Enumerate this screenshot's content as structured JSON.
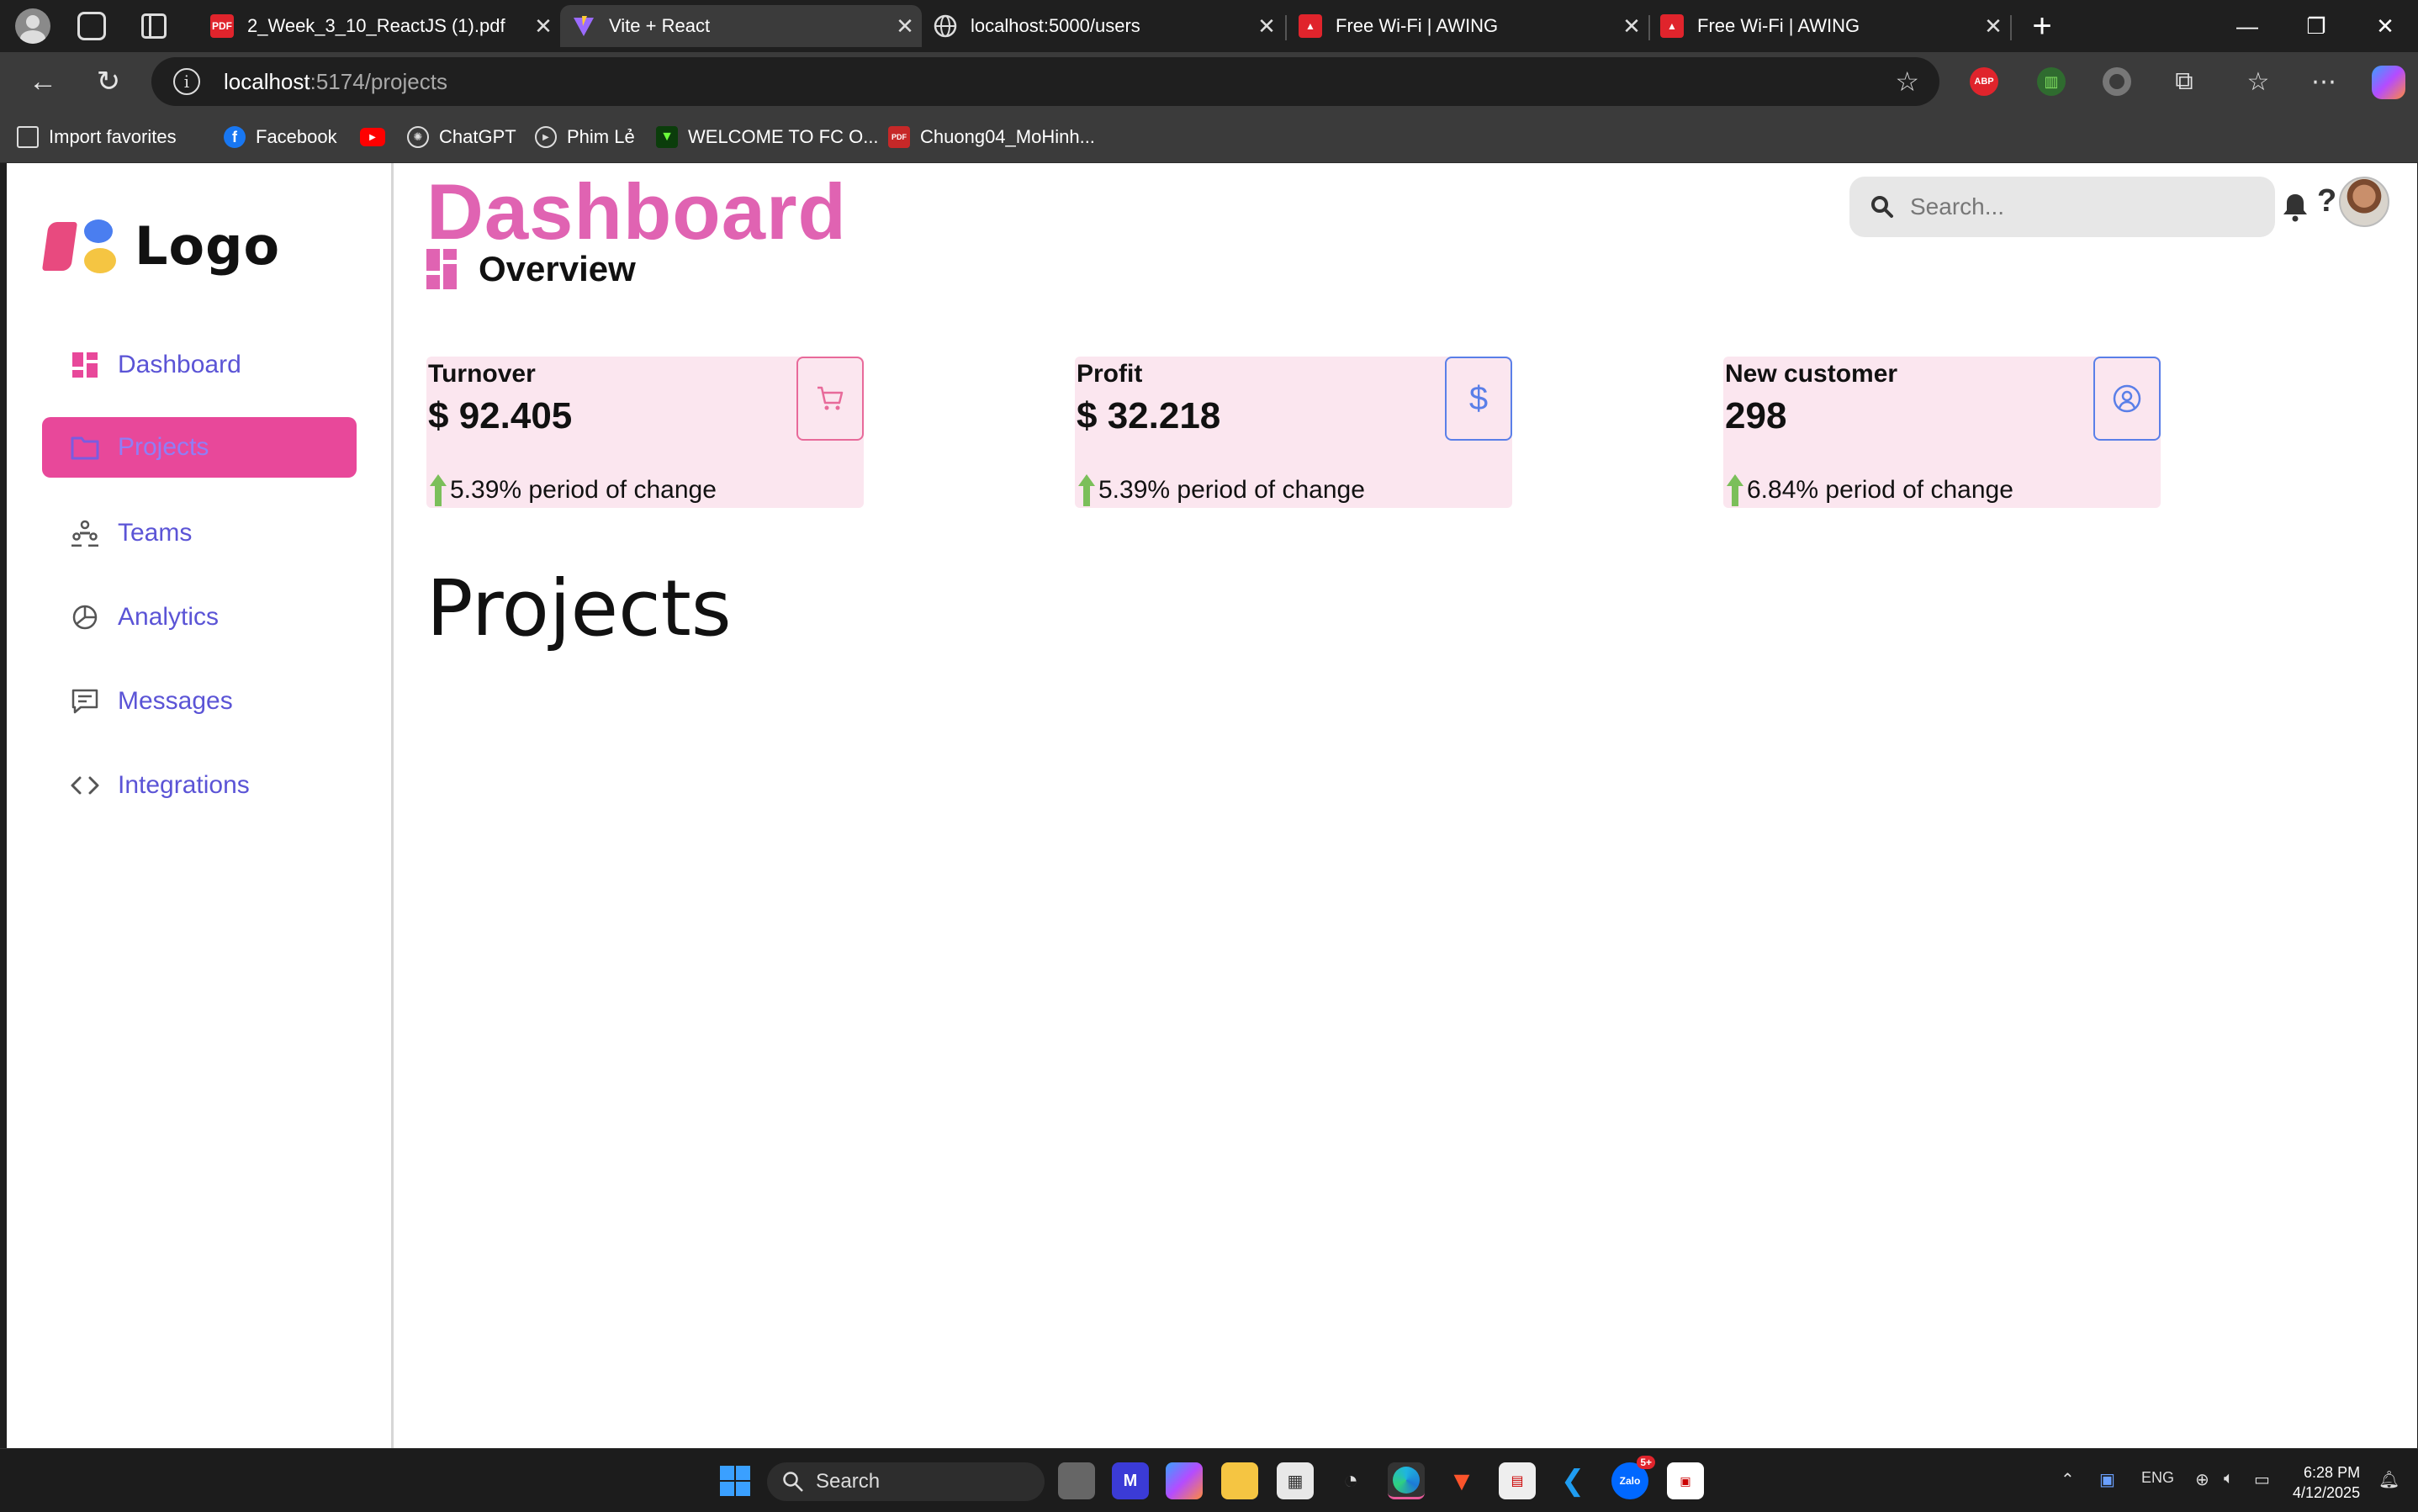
{
  "browser": {
    "tabs": [
      {
        "title": "2_Week_3_10_ReactJS (1).pdf",
        "favicon": "pdf-icon",
        "favicon_text": "PDF",
        "active": false
      },
      {
        "title": "Vite + React",
        "favicon": "vite-icon",
        "active": true
      },
      {
        "title": "localhost:5000/users",
        "favicon": "globe-icon",
        "active": false
      },
      {
        "title": "Free Wi-Fi | AWING",
        "favicon": "awing-icon",
        "active": false
      },
      {
        "title": "Free Wi-Fi | AWING",
        "favicon": "awing-icon",
        "active": false
      }
    ],
    "address": {
      "host": "localhost",
      "path": ":5174/projects"
    },
    "extensions": [
      {
        "name": "adblock-icon",
        "text": "ABP",
        "color": "#e0242c"
      },
      {
        "name": "extension-green-icon",
        "text": "",
        "color": "#4caf50"
      }
    ],
    "bookmarks": [
      {
        "label": "Import favorites",
        "icon": "import-icon"
      },
      {
        "label": "Facebook",
        "icon": "facebook-icon"
      },
      {
        "label": "",
        "icon": "youtube-icon"
      },
      {
        "label": "ChatGPT",
        "icon": "chatgpt-icon"
      },
      {
        "label": "Phim Lẻ",
        "icon": "film-icon"
      },
      {
        "label": "WELCOME TO FC O...",
        "icon": "fc-icon"
      },
      {
        "label": "Chuong04_MoHinh...",
        "icon": "pdf-icon",
        "icon_text": "PDF"
      }
    ]
  },
  "sidebar": {
    "logo_text": "Logo",
    "items": [
      {
        "label": "Dashboard",
        "icon": "grid-icon",
        "active": false
      },
      {
        "label": "Projects",
        "icon": "folder-icon",
        "active": true
      },
      {
        "label": "Teams",
        "icon": "teams-icon",
        "active": false
      },
      {
        "label": "Analytics",
        "icon": "pie-chart-icon",
        "active": false
      },
      {
        "label": "Messages",
        "icon": "message-icon",
        "active": false
      },
      {
        "label": "Integrations",
        "icon": "code-icon",
        "active": false
      }
    ]
  },
  "header": {
    "title": "Dashboard",
    "subtitle": "Overview",
    "search_placeholder": "Search...",
    "help_label": "?"
  },
  "cards": [
    {
      "title": "Turnover",
      "value": "$ 92.405",
      "change": "5.39% period of change",
      "icon": "cart-icon",
      "color": "#e86a9a"
    },
    {
      "title": "Profit",
      "value": "$ 32.218",
      "change": "5.39% period of change",
      "icon": "dollar-icon",
      "icon_text": "$",
      "color": "#5a7fe8"
    },
    {
      "title": "New customer",
      "value": "298",
      "change": "6.84% period of change",
      "icon": "user-circle-icon",
      "color": "#5a7fe8"
    }
  ],
  "main": {
    "heading": "Projects"
  },
  "taskbar": {
    "search_label": "Search",
    "lang": "ENG",
    "time": "6:28 PM",
    "date": "4/12/2025",
    "notification_badge": "5+"
  },
  "colors": {
    "accent_pink": "#e063b2",
    "nav_active_bg": "#e8489a",
    "nav_text": "#5b54d6",
    "card_bg": "#fbe6ef"
  }
}
